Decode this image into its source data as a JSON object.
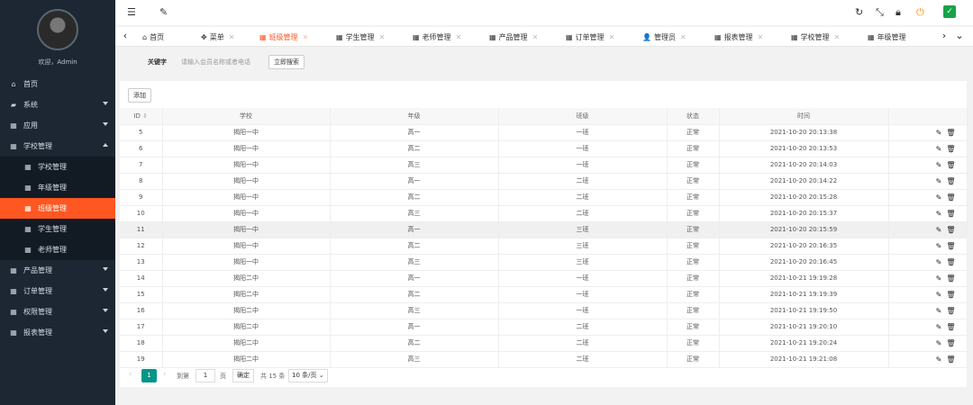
{
  "sidebar": {
    "welcome": "欢迎，Admin",
    "menu": [
      {
        "icon": "home-icon",
        "glyph": "⌂",
        "label": "首页",
        "caret": ""
      },
      {
        "icon": "system-icon",
        "glyph": "▰",
        "label": "系统",
        "caret": "down"
      },
      {
        "icon": "app-icon",
        "glyph": "▦",
        "label": "应用",
        "caret": "down"
      },
      {
        "icon": "school-admin-icon",
        "glyph": "▦",
        "label": "学校管理",
        "caret": "up"
      },
      {
        "icon": "school-icon",
        "glyph": "▦",
        "label": "学校管理",
        "sub": true
      },
      {
        "icon": "grade-icon",
        "glyph": "▦",
        "label": "年级管理",
        "sub": true
      },
      {
        "icon": "class-icon",
        "glyph": "▦",
        "label": "班级管理",
        "sub": true,
        "active": true
      },
      {
        "icon": "student-icon",
        "glyph": "▦",
        "label": "学生管理",
        "sub": true
      },
      {
        "icon": "teacher-icon",
        "glyph": "▦",
        "label": "老师管理",
        "sub": true
      },
      {
        "icon": "product-icon",
        "glyph": "▦",
        "label": "产品管理",
        "caret": "down"
      },
      {
        "icon": "order-icon",
        "glyph": "▦",
        "label": "订单管理",
        "caret": "down"
      },
      {
        "icon": "permission-icon",
        "glyph": "▦",
        "label": "权限管理",
        "caret": "down"
      },
      {
        "icon": "report-icon",
        "glyph": "▦",
        "label": "报表管理",
        "caret": "down"
      }
    ]
  },
  "header": {
    "accent": "#ff5722",
    "check_color": "#16a34a"
  },
  "tabs": [
    {
      "icon": "home-icon",
      "glyph": "⌂",
      "label": "首页",
      "closable": false
    },
    {
      "icon": "menu-icon",
      "glyph": "✥",
      "label": "菜单",
      "closable": true
    },
    {
      "icon": "class-tab-icon",
      "glyph": "▦",
      "label": "班级管理",
      "closable": true,
      "current": true
    },
    {
      "icon": "student-tab-icon",
      "glyph": "▦",
      "label": "学生管理",
      "closable": true
    },
    {
      "icon": "teacher-tab-icon",
      "glyph": "▦",
      "label": "老师管理",
      "closable": true
    },
    {
      "icon": "product-tab-icon",
      "glyph": "▦",
      "label": "产品管理",
      "closable": true
    },
    {
      "icon": "order-tab-icon",
      "glyph": "▦",
      "label": "订单管理",
      "closable": true
    },
    {
      "icon": "user-icon",
      "glyph": "👤",
      "label": "管理员",
      "closable": true
    },
    {
      "icon": "report-tab-icon",
      "glyph": "▦",
      "label": "报表管理",
      "closable": true
    },
    {
      "icon": "school-tab-icon",
      "glyph": "▦",
      "label": "学校管理",
      "closable": true
    },
    {
      "icon": "grade-tab-icon",
      "glyph": "▦",
      "label": "年级管理",
      "closable": false
    }
  ],
  "search": {
    "keyword_label": "关键字",
    "placeholder": "请输入会员名称或者电话",
    "button": "立即搜索"
  },
  "add_button": "添加",
  "table": {
    "columns": [
      "ID",
      "学校",
      "年级",
      "班级",
      "状态",
      "时间",
      ""
    ],
    "rows": [
      [
        "5",
        "揭阳一中",
        "高一",
        "一班",
        "正常",
        "2021-10-20 20:13:38"
      ],
      [
        "6",
        "揭阳一中",
        "高二",
        "一班",
        "正常",
        "2021-10-20 20:13:53"
      ],
      [
        "7",
        "揭阳一中",
        "高三",
        "一班",
        "正常",
        "2021-10-20 20:14:03"
      ],
      [
        "8",
        "揭阳一中",
        "高一",
        "二班",
        "正常",
        "2021-10-20 20:14:22"
      ],
      [
        "9",
        "揭阳一中",
        "高二",
        "二班",
        "正常",
        "2021-10-20 20:15:28"
      ],
      [
        "10",
        "揭阳一中",
        "高三",
        "二班",
        "正常",
        "2021-10-20 20:15:37"
      ],
      [
        "11",
        "揭阳一中",
        "高一",
        "三班",
        "正常",
        "2021-10-20 20:15:59"
      ],
      [
        "12",
        "揭阳一中",
        "高二",
        "三班",
        "正常",
        "2021-10-20 20:16:35"
      ],
      [
        "13",
        "揭阳一中",
        "高三",
        "三班",
        "正常",
        "2021-10-20 20:16:45"
      ],
      [
        "14",
        "揭阳二中",
        "高一",
        "一班",
        "正常",
        "2021-10-21 19:19:28"
      ],
      [
        "15",
        "揭阳二中",
        "高二",
        "一班",
        "正常",
        "2021-10-21 19:19:39"
      ],
      [
        "16",
        "揭阳二中",
        "高三",
        "一班",
        "正常",
        "2021-10-21 19:19:50"
      ],
      [
        "17",
        "揭阳二中",
        "高一",
        "二班",
        "正常",
        "2021-10-21 19:20:10"
      ],
      [
        "18",
        "揭阳二中",
        "高二",
        "二班",
        "正常",
        "2021-10-21 19:20:24"
      ],
      [
        "19",
        "揭阳二中",
        "高三",
        "二班",
        "正常",
        "2021-10-21 19:21:08"
      ]
    ],
    "highlight_row": 6
  },
  "pager": {
    "current": "1",
    "goto_label": "到第",
    "page_value": "1",
    "page_unit": "页",
    "go_button": "确定",
    "total": "共 15 条",
    "page_size": "10 条/页"
  }
}
